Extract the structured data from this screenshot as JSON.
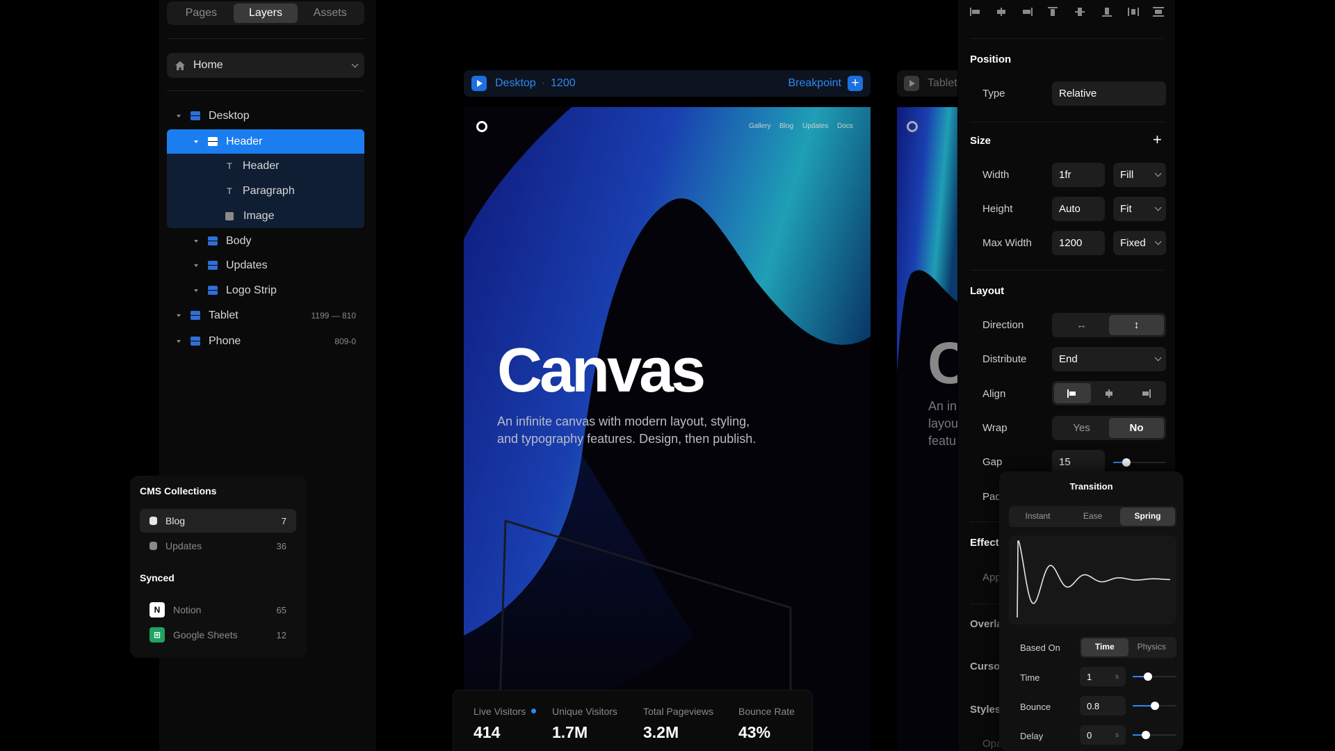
{
  "left_panel": {
    "tabs": [
      {
        "label": "Pages",
        "active": false
      },
      {
        "label": "Layers",
        "active": true
      },
      {
        "label": "Assets",
        "active": false
      }
    ],
    "page_select": {
      "label": "Home",
      "icon": "home-icon"
    },
    "layers": [
      {
        "label": "Desktop",
        "icon": "stack-icon",
        "depth": 0,
        "meta": ""
      },
      {
        "label": "Header",
        "icon": "stack-icon",
        "depth": 1,
        "selected": true
      },
      {
        "label": "Header",
        "icon": "text-icon",
        "depth": 2
      },
      {
        "label": "Paragraph",
        "icon": "text-icon",
        "depth": 2
      },
      {
        "label": "Image",
        "icon": "image-icon",
        "depth": 2
      },
      {
        "label": "Body",
        "icon": "stack-icon",
        "depth": 1
      },
      {
        "label": "Updates",
        "icon": "stack-icon",
        "depth": 1
      },
      {
        "label": "Logo Strip",
        "icon": "stack-icon",
        "depth": 1
      },
      {
        "label": "Tablet",
        "icon": "stack-icon",
        "depth": 0,
        "meta": "1199 — 810"
      },
      {
        "label": "Phone",
        "icon": "stack-icon",
        "depth": 0,
        "meta": "809-0"
      }
    ]
  },
  "cms": {
    "collections_title": "CMS Collections",
    "collections": [
      {
        "label": "Blog",
        "count": "7",
        "active": true
      },
      {
        "label": "Updates",
        "count": "36",
        "active": false
      }
    ],
    "synced_title": "Synced",
    "synced": [
      {
        "label": "Notion",
        "count": "65",
        "icon": "notion-icon",
        "glyph": "N"
      },
      {
        "label": "Google Sheets",
        "count": "12",
        "icon": "google-sheets-icon",
        "glyph": "⊞"
      }
    ]
  },
  "canvas": {
    "desktop_bar": {
      "name": "Desktop",
      "separator": "·",
      "width": "1200",
      "breakpoint_label": "Breakpoint",
      "add_label": "+"
    },
    "tablet_bar": {
      "name": "Tablet"
    },
    "site_nav": [
      "Gallery",
      "Blog",
      "Updates",
      "Docs"
    ],
    "hero_title": "Canvas",
    "hero_text_line1": "An infinite canvas with modern layout, styling,",
    "hero_text_line2": "and typography features. Design, then publish.",
    "tablet_hero_title": "C",
    "tablet_text": [
      "An in",
      "layou",
      "featu"
    ],
    "colors": {
      "accent": "#2f87f2",
      "wave_dark": "#1b2c9c",
      "wave_light": "#1fa6b8"
    }
  },
  "stats": [
    {
      "label": "Live Visitors",
      "value": "414",
      "live_dot": true
    },
    {
      "label": "Unique Visitors",
      "value": "1.7M"
    },
    {
      "label": "Total Pageviews",
      "value": "3.2M"
    },
    {
      "label": "Bounce Rate",
      "value": "43%"
    }
  ],
  "right_panel": {
    "align_icons": [
      "align-left-icon",
      "align-center-h-icon",
      "align-right-icon",
      "align-top-icon",
      "align-middle-v-icon",
      "align-bottom-icon",
      "distribute-h-icon",
      "distribute-v-icon"
    ],
    "position": {
      "title": "Position",
      "type_label": "Type",
      "type_value": "Relative"
    },
    "size": {
      "title": "Size",
      "add": "+",
      "width_label": "Width",
      "width_value": "1fr",
      "width_mode": "Fill",
      "height_label": "Height",
      "height_value": "Auto",
      "height_mode": "Fit",
      "maxw_label": "Max Width",
      "maxw_value": "1200",
      "maxw_mode": "Fixed"
    },
    "layout": {
      "title": "Layout",
      "direction_label": "Direction",
      "direction_h": "↔",
      "direction_v": "↕",
      "direction_active": "vertical",
      "distribute_label": "Distribute",
      "distribute_value": "End",
      "align_label": "Align",
      "wrap_label": "Wrap",
      "wrap_yes": "Yes",
      "wrap_no": "No",
      "wrap_active": "No",
      "gap_label": "Gap",
      "gap_value": "15",
      "gap_slider": 0.25,
      "padding_label": "Padd"
    },
    "effects_title": "Effects",
    "effects_appear": "Appe",
    "overlay_title": "Overla",
    "cursor_title": "Curso",
    "styles_title": "Styles",
    "opacity_label": "Opa"
  },
  "transition": {
    "title": "Transition",
    "types": [
      {
        "label": "Instant",
        "active": false
      },
      {
        "label": "Ease",
        "active": false
      },
      {
        "label": "Spring",
        "active": true
      }
    ],
    "based_on_label": "Based On",
    "based_on": [
      {
        "label": "Time",
        "active": true
      },
      {
        "label": "Physics",
        "active": false
      }
    ],
    "time_label": "Time",
    "time_value": "1",
    "time_unit": "s",
    "time_slider": 0.35,
    "bounce_label": "Bounce",
    "bounce_value": "0.8",
    "bounce_slider": 0.5,
    "delay_label": "Delay",
    "delay_value": "0",
    "delay_unit": "s",
    "delay_slider": 0.3
  }
}
